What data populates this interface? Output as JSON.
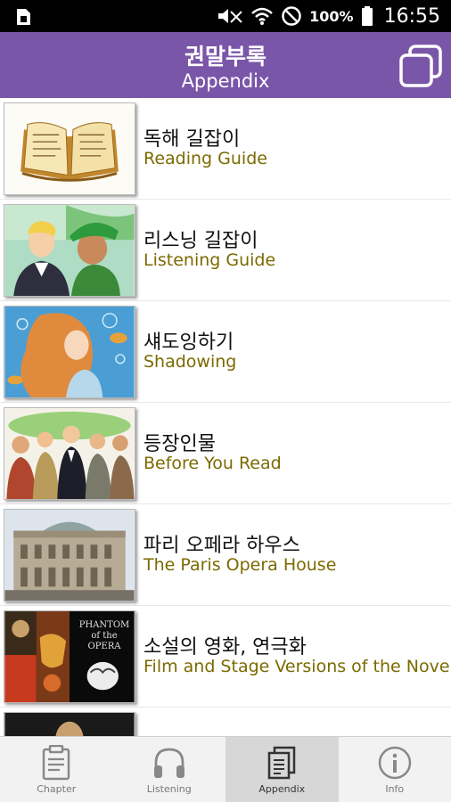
{
  "status_bar": {
    "battery": "100%",
    "time": "16:55",
    "icons": [
      "sim-icon",
      "mute-icon",
      "wifi-icon",
      "no-entry-icon",
      "battery-icon"
    ]
  },
  "header": {
    "title_ko": "권말부록",
    "title_en": "Appendix",
    "action_icon": "copy-pages-icon"
  },
  "items": [
    {
      "ko": "독해 길잡이",
      "en": "Reading Guide",
      "thumb": "open-book-illustration"
    },
    {
      "ko": "리스닝 길잡이",
      "en": "Listening Guide",
      "thumb": "two-characters-illustration"
    },
    {
      "ko": "섀도잉하기",
      "en": "Shadowing",
      "thumb": "underwater-girl-illustration"
    },
    {
      "ko": "등장인물",
      "en": "Before You Read",
      "thumb": "group-characters-illustration"
    },
    {
      "ko": "파리 오페라 하우스",
      "en": "The Paris Opera House",
      "thumb": "opera-house-photo"
    },
    {
      "ko": "소설의 영화, 연극화",
      "en": "Film and Stage Versions of the Novel",
      "thumb": "posters-collage",
      "poster_text": "PHANTOM of the OPERA"
    },
    {
      "ko": "",
      "en": "",
      "thumb": "partial-thumbnail"
    }
  ],
  "nav": [
    {
      "label": "Chapter",
      "icon": "clipboard-icon",
      "active": false
    },
    {
      "label": "Listening",
      "icon": "headphones-icon",
      "active": false
    },
    {
      "label": "Appendix",
      "icon": "pages-icon",
      "active": true
    },
    {
      "label": "Info",
      "icon": "info-icon",
      "active": false
    }
  ],
  "colors": {
    "header": "#7a56a8",
    "subtitle": "#7b6a00",
    "nav_bg": "#f2f2f2",
    "nav_active": "#d7d7d7"
  }
}
